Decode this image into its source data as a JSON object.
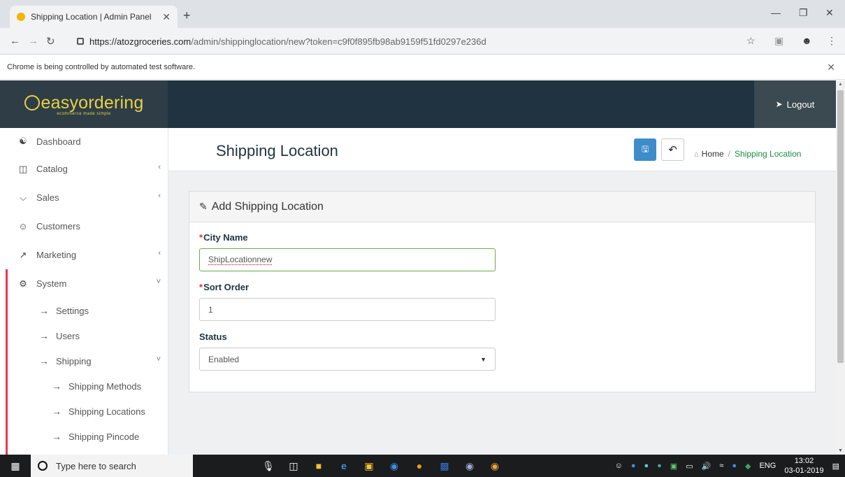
{
  "browser": {
    "tab_title": "Shipping Location | Admin Panel",
    "tab_close": "✕",
    "new_tab": "+",
    "url_host": "https://atozgroceries.com",
    "url_path": "/admin/shippinglocation/new?token=c9f0f895fb98ab9159f51fd0297e236d",
    "infobar_text": "Chrome is being controlled by automated test software.",
    "infobar_close": "✕"
  },
  "header": {
    "logo_text": "easyordering",
    "logo_sub": "ecommerce made simple",
    "logout_label": "Logout"
  },
  "sidebar": {
    "items": [
      {
        "label": "Dashboard",
        "icon": "dashboard-icon",
        "chevron": ""
      },
      {
        "label": "Catalog",
        "icon": "tag-icon",
        "chevron": "‹"
      },
      {
        "label": "Sales",
        "icon": "cart-icon",
        "chevron": "‹"
      },
      {
        "label": "Customers",
        "icon": "user-icon",
        "chevron": ""
      },
      {
        "label": "Marketing",
        "icon": "share-icon",
        "chevron": "‹"
      },
      {
        "label": "System",
        "icon": "gear-icon",
        "chevron": "˅"
      }
    ],
    "system_sub": [
      {
        "label": "Settings"
      },
      {
        "label": "Users"
      },
      {
        "label": "Shipping",
        "chevron": "˅"
      }
    ],
    "shipping_sub": [
      {
        "label": "Shipping Methods"
      },
      {
        "label": "Shipping Locations"
      },
      {
        "label": "Shipping Pincode"
      }
    ]
  },
  "page": {
    "title": "Shipping Location",
    "breadcrumb_home": "Home",
    "breadcrumb_sep": "/",
    "breadcrumb_current": "Shipping Location"
  },
  "form": {
    "panel_title": "Add Shipping Location",
    "city_label": "City Name",
    "city_value": "ShipLocationnew",
    "sort_label": "Sort Order",
    "sort_value": "1",
    "status_label": "Status",
    "status_value": "Enabled",
    "required_mark": "*"
  },
  "taskbar": {
    "search_placeholder": "Type here to search",
    "lang": "ENG",
    "time": "13:02",
    "date": "03-01-2019"
  },
  "colors": {
    "header_bg": "#1f3440",
    "logo": "#e7d247",
    "accent_save": "#3c8dca",
    "breadcrumb_active": "#1f8a49",
    "sidebar_active_bar": "#e8384f"
  }
}
